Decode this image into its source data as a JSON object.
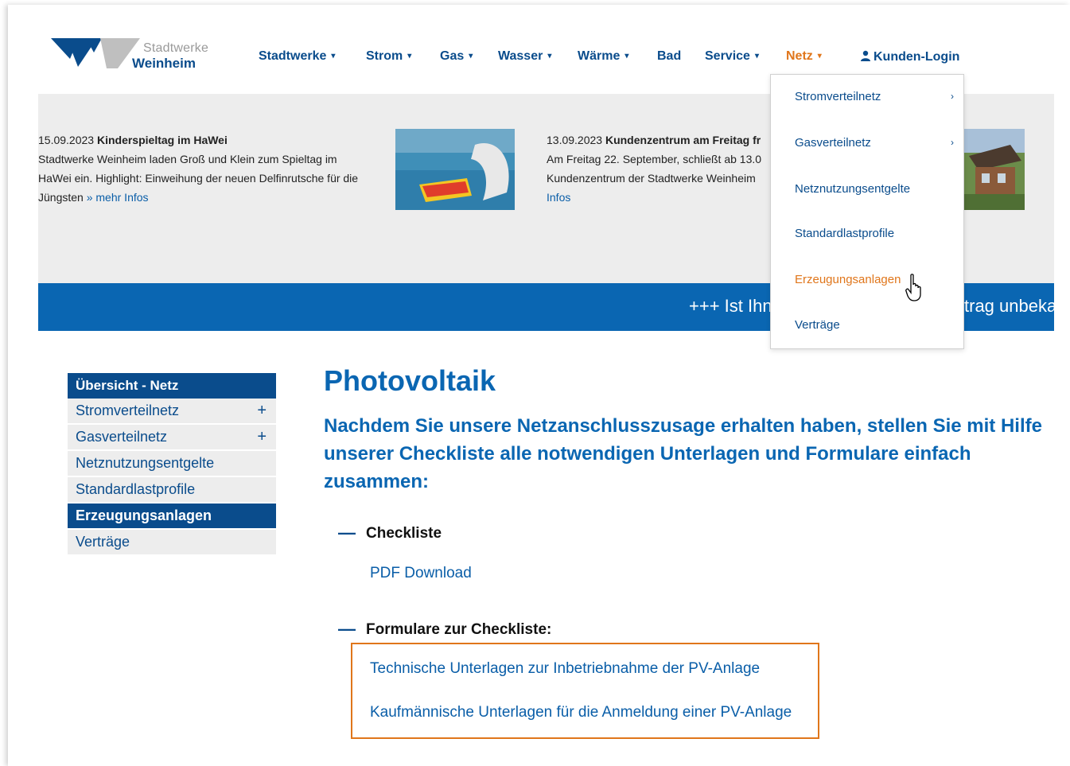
{
  "brand": {
    "name_top": "Stadtwerke",
    "name_bottom": "Weinheim",
    "colors": {
      "primary": "#0a4c8c",
      "accent": "#e0761b",
      "banner": "#0a66b2",
      "strip": "#ededed"
    }
  },
  "nav": {
    "items": [
      {
        "label": "Stadtwerke",
        "caret": "▾"
      },
      {
        "label": "Strom",
        "caret": "▾"
      },
      {
        "label": "Gas",
        "caret": "▾"
      },
      {
        "label": "Wasser",
        "caret": "▾"
      },
      {
        "label": "Wärme",
        "caret": "▾"
      },
      {
        "label": "Bad",
        "caret": ""
      },
      {
        "label": "Service",
        "caret": "▾"
      },
      {
        "label": "Netz",
        "caret": "▾"
      }
    ],
    "login_label": "Kunden-Login",
    "login_icon": "user-icon"
  },
  "news": [
    {
      "date": "15.09.2023",
      "title": "Kinderspieltag im HaWei",
      "text": "Stadtwerke Weinheim laden Groß und Klein zum Spieltag im HaWei ein. Highlight: Einweihung der neuen Delfinrutsche für die Jüngsten",
      "link": "» mehr Infos"
    },
    {
      "date": "13.09.2023",
      "title": "Kundenzentrum am Freitag fr",
      "line1": "Am Freitag 22. September, schließt ab 13.0",
      "line2": "Kundenzentrum der Stadtwerke Weinheim",
      "link": "Infos"
    }
  ],
  "ticker": {
    "left": "+++ Ist Ihn",
    "right": "trag unbeka"
  },
  "dropdown": {
    "items": [
      {
        "label": "Stromverteilnetz",
        "chevron": "›"
      },
      {
        "label": "Gasverteilnetz",
        "chevron": "›"
      },
      {
        "label": "Netznutzungsentgelte",
        "chevron": ""
      },
      {
        "label": "Standardlastprofile",
        "chevron": ""
      },
      {
        "label": "Erzeugungsanlagen",
        "chevron": ""
      },
      {
        "label": "Verträge",
        "chevron": ""
      }
    ],
    "active_index": 4
  },
  "sidebar": {
    "header": "Übersicht - Netz",
    "items": [
      {
        "label": "Stromverteilnetz",
        "expand": "+"
      },
      {
        "label": "Gasverteilnetz",
        "expand": "+"
      },
      {
        "label": "Netznutzungsentgelte",
        "expand": ""
      },
      {
        "label": "Standardlastprofile",
        "expand": ""
      },
      {
        "label": "Erzeugungsanlagen",
        "expand": ""
      },
      {
        "label": "Verträge",
        "expand": ""
      }
    ],
    "active_index": 4
  },
  "main": {
    "title": "Photovoltaik",
    "intro_lines": [
      "Nachdem Sie unsere Netzanschlusszusage erhalten haben, stellen Sie mit Hilfe",
      "unserer Checkliste alle notwendigen Unterlagen und Formulare einfach",
      "zusammen:"
    ],
    "sections": [
      {
        "dash": "—",
        "title": "Checkliste",
        "links": [
          "PDF Download"
        ]
      },
      {
        "dash": "—",
        "title": "Formulare zur Checkliste:",
        "links": [
          "Technische Unterlagen zur Inbetriebnahme der PV-Anlage",
          "Kaufmännische Unterlagen für die Anmeldung einer PV-Anlage"
        ]
      }
    ]
  }
}
